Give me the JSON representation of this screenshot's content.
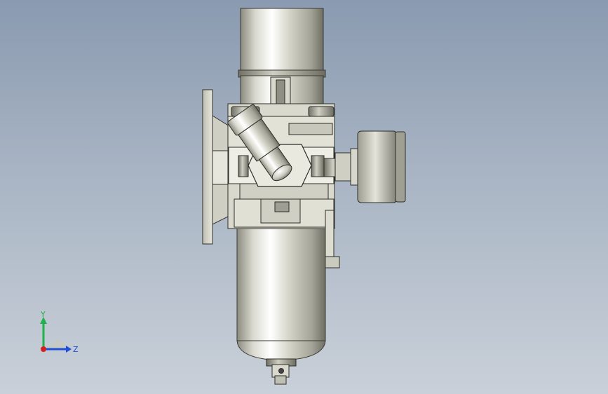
{
  "viewport": {
    "background_top": "#8a9ab0",
    "background_bottom": "#c9d0d9"
  },
  "model": {
    "metal_light": "#f2f2ea",
    "metal_mid": "#c8c8bc",
    "metal_dark": "#7d7d72",
    "edge": "#2e2e2a"
  },
  "triad": {
    "y_label": "Y",
    "z_label": "Z",
    "y_color": "#22b14c",
    "z_color": "#1f4fd6",
    "x_color": "#d62020"
  }
}
